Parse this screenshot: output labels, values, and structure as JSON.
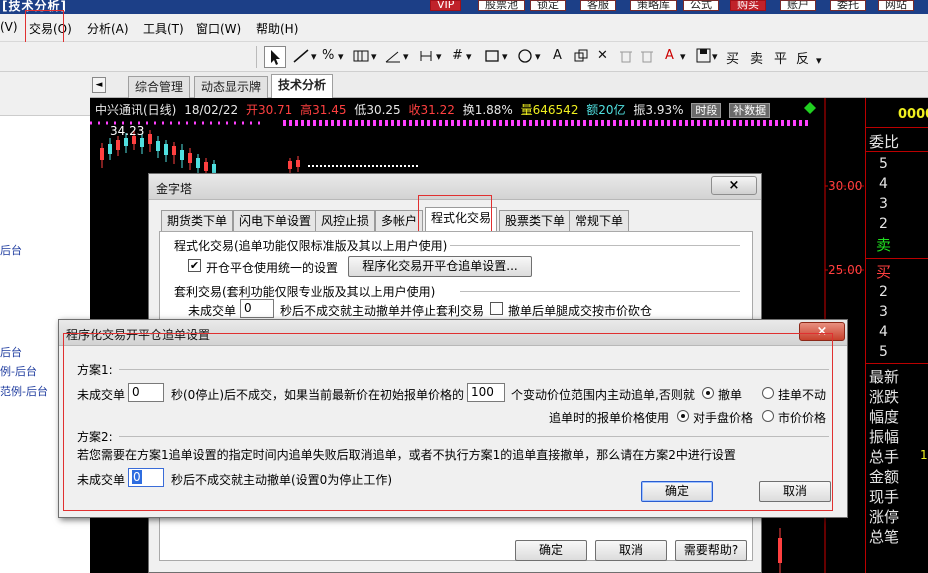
{
  "app_title": "[技术分析]",
  "top_buttons": [
    "VIP",
    "股票池",
    "锁定",
    "客服",
    "策略库",
    "公式",
    "购买",
    "账户",
    "委托",
    "网站"
  ],
  "menu": {
    "items": [
      "(V)",
      "交易(O)",
      "分析(A)",
      "工具(T)",
      "窗口(W)",
      "帮助(H)"
    ]
  },
  "toolbar": {
    "icons": [
      "cursor-icon",
      "line-icon",
      "percent-icon",
      "parallel-lines-icon",
      "angle-icon",
      "fibonacci-icon",
      "grid-icon",
      "rectangle-icon",
      "circle-icon",
      "text-icon",
      "copy-icon",
      "delete-icon",
      "trash-icon",
      "color-icon",
      "save-icon"
    ],
    "text_items": [
      "A",
      "买",
      "卖",
      "平",
      "反"
    ]
  },
  "sidebar": {
    "items": [
      "后台",
      "后台",
      "例-后台",
      "范例-后台"
    ]
  },
  "view_tabs": [
    "综合管理",
    "动态显示牌",
    "技术分析"
  ],
  "stock": {
    "name": "中兴通讯(日线)",
    "date": "18/02/22",
    "open": "开30.71",
    "high": "高31.45",
    "low": "低30.25",
    "close": "收31.22",
    "turnover": "换1.88%",
    "volume": "量646542",
    "amount": "额20亿",
    "amplitude": "振3.93%",
    "chip1": "时段",
    "chip2": "补数据",
    "hi_price": "34.23",
    "price_labels": [
      "30.00",
      "25.00"
    ]
  },
  "right_panel": {
    "top_value": "0000",
    "wb": "委比",
    "sell_levels": [
      "5",
      "4",
      "3",
      "2"
    ],
    "sell": "卖",
    "buy": "买",
    "buy_levels": [
      "2",
      "3",
      "4",
      "5"
    ],
    "stats": [
      "最新",
      "涨跌",
      "幅度",
      "振幅",
      "总手",
      "金额",
      "现手",
      "涨停",
      "总笔"
    ],
    "side_value": "1"
  },
  "jzt_dialog": {
    "title": "金字塔",
    "close": "×",
    "tabs": [
      "期货类下单",
      "闪电下单设置",
      "风控止损",
      "多帐户",
      "程式化交易",
      "股票类下单",
      "常规下单"
    ],
    "section1": "程式化交易(追单功能仅限标准版及其以上用户使用)",
    "check1": "开仓平仓使用统一的设置",
    "btn_settings": "程序化交易开平仓追单设置...",
    "section2": "套利交易(套利功能仅限专业版及其以上用户使用)",
    "unfilled_label": "未成交单",
    "unfilled_value": "0",
    "unfilled_text": "秒后不成交就主动撤单并停止套利交易",
    "check2": "撤单后单腿成交按市价砍仓",
    "ok": "确定",
    "cancel": "取消",
    "help": "需要帮助?"
  },
  "zd_dialog": {
    "title": "程序化交易开平仓追单设置",
    "close": "×",
    "plan1": "方案1:",
    "p1_label": "未成交单",
    "p1_value": "0",
    "p1_text1": "秒(0停止)后不成交，如果当前最新价在初始报单价格的",
    "p1_value2": "100",
    "p1_text2": "个变动价位范围内主动追单,否则就",
    "radio_cancel": "撤单",
    "radio_order": "挂单不动",
    "price_label": "追单时的报单价格使用",
    "radio_opp": "对手盘价格",
    "radio_market": "市价价格",
    "plan2": "方案2:",
    "plan2_desc": "若您需要在方案1追单设置的指定时间内追单失败后取消追单，或者不执行方案1的追单直接撤单，那么请在方案2中进行设置",
    "p2_label": "未成交单",
    "p2_value": "0",
    "p2_text": "秒后不成交就主动撤单(设置0为停止工作)",
    "ok": "确定",
    "cancel": "取消"
  }
}
